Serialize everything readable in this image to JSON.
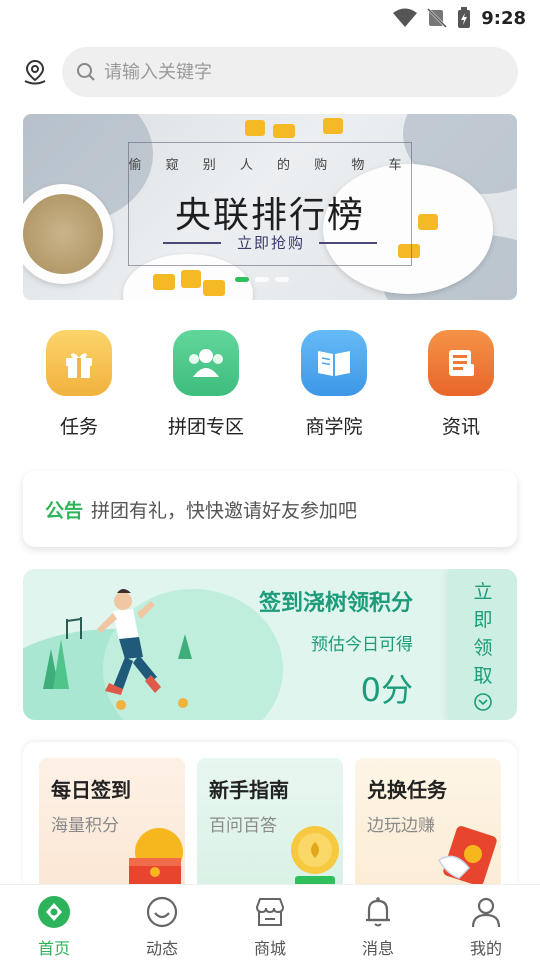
{
  "status_bar": {
    "time": "9:28"
  },
  "search": {
    "placeholder": "请输入关键字"
  },
  "banner": {
    "subtitle": "偷 窥 别 人 的 购 物 车",
    "title": "央联排行榜",
    "button": "立即抢购"
  },
  "quick_menu": [
    {
      "label": "任务",
      "icon": "gift-icon",
      "color": "#f6bf4f"
    },
    {
      "label": "拼团专区",
      "icon": "group-icon",
      "color": "#4fc98a"
    },
    {
      "label": "商学院",
      "icon": "book-icon",
      "color": "#4aa6ee"
    },
    {
      "label": "资讯",
      "icon": "news-icon",
      "color": "#f07a33"
    }
  ],
  "notice": {
    "tag": "公告",
    "text": "拼团有礼，快快邀请好友参加吧"
  },
  "checkin": {
    "title": "签到浇树领积分",
    "subtitle": "预估今日可得",
    "points": "0分",
    "action": [
      "立",
      "即",
      "领",
      "取"
    ]
  },
  "tasks": [
    {
      "title": "每日签到",
      "subtitle": "海量积分",
      "bg": "#fdf0e4"
    },
    {
      "title": "新手指南",
      "subtitle": "百问百答",
      "bg": "#e6f6ee"
    },
    {
      "title": "兑换任务",
      "subtitle": "边玩边赚",
      "bg": "#fdf3e4"
    }
  ],
  "bottom_nav": [
    {
      "label": "首页",
      "icon": "home-icon",
      "active": true
    },
    {
      "label": "动态",
      "icon": "smile-icon",
      "active": false
    },
    {
      "label": "商城",
      "icon": "store-icon",
      "active": false
    },
    {
      "label": "消息",
      "icon": "bell-icon",
      "active": false
    },
    {
      "label": "我的",
      "icon": "user-icon",
      "active": false
    }
  ],
  "colors": {
    "accent": "#2db35a",
    "checkin_text": "#1c9c7a"
  }
}
